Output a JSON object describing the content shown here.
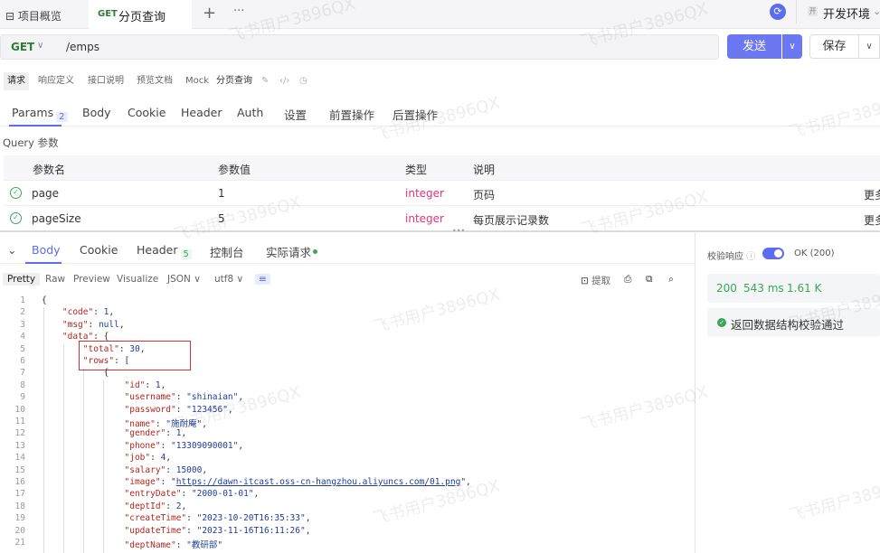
{
  "tabs": {
    "overview": "项目概览",
    "active_method": "GET",
    "active_title": "分页查询",
    "plus": "+",
    "more": "···"
  },
  "env": {
    "badge": "开",
    "name": "开发环境"
  },
  "request": {
    "method": "GET",
    "path": "/emps",
    "send_label": "发送",
    "save_label": "保存"
  },
  "subtabs": [
    "请求",
    "响应定义",
    "接口说明",
    "预览文档",
    "Mock",
    "分页查询"
  ],
  "param_tabs": [
    {
      "label": "Params",
      "badge": "2"
    },
    {
      "label": "Body"
    },
    {
      "label": "Cookie"
    },
    {
      "label": "Header"
    },
    {
      "label": "Auth"
    },
    {
      "label": "设置"
    },
    {
      "label": "前置操作"
    },
    {
      "label": "后置操作"
    }
  ],
  "query_label": "Query 参数",
  "params_table": {
    "headers": [
      "参数名",
      "参数值",
      "类型",
      "说明"
    ],
    "rows": [
      {
        "name": "page",
        "value": "1",
        "type": "integer",
        "desc": "页码",
        "extra": "更多"
      },
      {
        "name": "pageSize",
        "value": "5",
        "type": "integer",
        "desc": "每页展示记录数",
        "extra": "更多"
      }
    ]
  },
  "response_tabs": [
    {
      "label": "Body"
    },
    {
      "label": "Cookie"
    },
    {
      "label": "Header",
      "badge": "5"
    },
    {
      "label": "控制台"
    },
    {
      "label": "实际请求"
    }
  ],
  "format_bar": {
    "modes": [
      "Pretty",
      "Raw",
      "Preview",
      "Visualize"
    ],
    "format": "JSON",
    "encoding": "utf8",
    "extract": "提取"
  },
  "code_lines": [
    "{",
    "    \"code\": 1,",
    "    \"msg\": null,",
    "    \"data\": {",
    "        \"total\": 30,",
    "        \"rows\": [",
    "            {",
    "                \"id\": 1,",
    "                \"username\": \"shinaian\",",
    "                \"password\": \"123456\",",
    "                \"name\": \"施耐庵\",",
    "                \"gender\": 1,",
    "                \"phone\": \"13309090001\",",
    "                \"job\": 4,",
    "                \"salary\": 15000,",
    "                \"image\": \"https://dawn-itcast.oss-cn-hangzhou.aliyuncs.com/01.png\",",
    "                \"entryDate\": \"2000-01-01\",",
    "                \"deptId\": 2,",
    "                \"createTime\": \"2023-10-20T16:35:33\",",
    "                \"updateTime\": \"2023-11-16T16:11:26\",",
    "                \"deptName\": \"教研部\""
  ],
  "right_panel": {
    "validate_label": "校验响应",
    "status_text": "OK (200)",
    "status_code": "200",
    "time": "543 ms",
    "size": "1.61 K",
    "check_text": "返回数据结构校验通过"
  }
}
